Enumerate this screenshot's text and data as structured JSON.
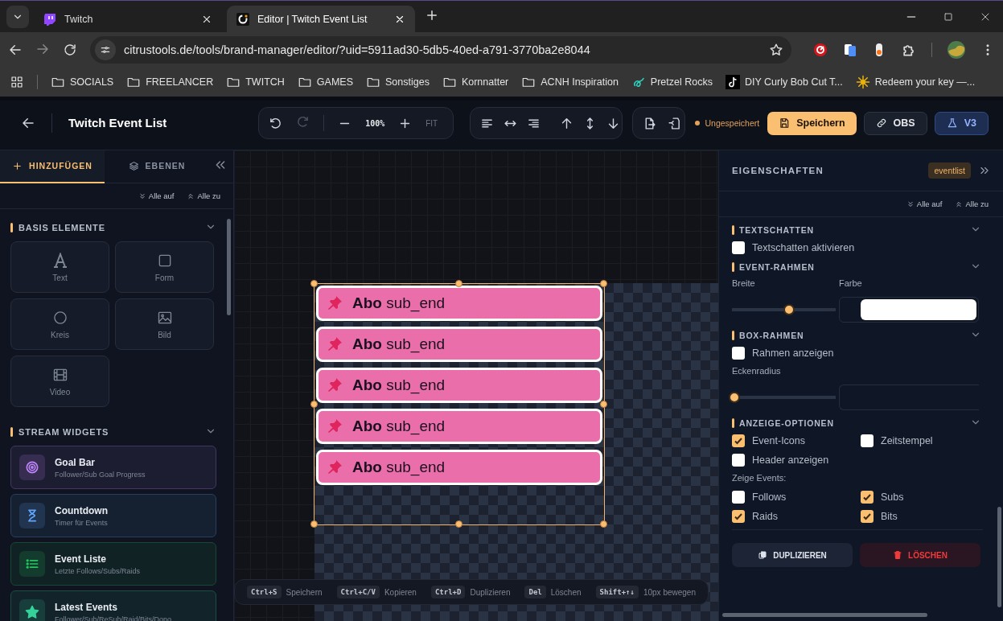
{
  "browser": {
    "tabs": [
      {
        "title": "Twitch",
        "kind": "twitch",
        "selected": false
      },
      {
        "title": "Editor | Twitch Event List",
        "kind": "citrus",
        "selected": true
      }
    ],
    "url": "citrustools.de/tools/brand-manager/editor/?uid=5911ad30-5db5-40ed-a791-3770ba2e8044",
    "bookmarks": [
      {
        "label": "SOCIALS",
        "kind": "folder"
      },
      {
        "label": "FREELANCER",
        "kind": "folder"
      },
      {
        "label": "TWITCH",
        "kind": "folder"
      },
      {
        "label": "GAMES",
        "kind": "folder"
      },
      {
        "label": "Sonstiges",
        "kind": "folder"
      },
      {
        "label": "Kornnatter",
        "kind": "folder"
      },
      {
        "label": "ACNH Inspiration",
        "kind": "folder"
      },
      {
        "label": "Pretzel Rocks",
        "kind": "swirl"
      },
      {
        "label": "DIY Curly Bob Cut T...",
        "kind": "note"
      },
      {
        "label": "Redeem your key —...",
        "kind": "emblem"
      }
    ]
  },
  "header": {
    "title": "Twitch Event List",
    "zoom": "100%",
    "fit": "FIT",
    "status": "Ungespeichert",
    "save": "Speichern",
    "obs": "OBS",
    "version": "V3"
  },
  "left_panel": {
    "tabs": [
      {
        "label": "HINZUFÜGEN",
        "kind": "plus",
        "selected": true
      },
      {
        "label": "EBENEN",
        "kind": "layers",
        "selected": false
      }
    ],
    "expand_all": "Alle auf",
    "collapse_all": "Alle zu",
    "basic_section": {
      "title": "BASIS ELEMENTE",
      "items": [
        {
          "label": "Text",
          "kind": "text"
        },
        {
          "label": "Form",
          "kind": "square"
        },
        {
          "label": "Kreis",
          "kind": "circle"
        },
        {
          "label": "Bild",
          "kind": "image"
        },
        {
          "label": "Video",
          "kind": "film"
        }
      ]
    },
    "widget_section": {
      "title": "STREAM WIDGETS",
      "items": [
        {
          "title": "Goal Bar",
          "subtitle": "Follower/Sub Goal Progress",
          "kind": "target",
          "color": "#c084fc"
        },
        {
          "title": "Countdown",
          "subtitle": "Timer für Events",
          "kind": "hourglass",
          "color": "#60a5fa"
        },
        {
          "title": "Event Liste",
          "subtitle": "Letzte Follows/Subs/Raids",
          "kind": "list",
          "color": "#22c55e"
        },
        {
          "title": "Latest Events",
          "subtitle": "Follower/Sub/ReSub/Raid/Bits/Dono",
          "kind": "star",
          "color": "#34d399"
        }
      ]
    }
  },
  "canvas": {
    "events": [
      {
        "text": "**Abo** sub_end"
      },
      {
        "text": "**Abo** sub_end"
      },
      {
        "text": "**Abo** sub_end"
      },
      {
        "text": "**Abo** sub_end"
      },
      {
        "text": "**Abo** sub_end"
      }
    ],
    "shortcuts": [
      {
        "key": "Ctrl+S",
        "label": "Speichern"
      },
      {
        "key": "Ctrl+C/V",
        "label": "Kopieren"
      },
      {
        "key": "Ctrl+D",
        "label": "Duplizieren"
      },
      {
        "key": "Del",
        "label": "Löschen"
      },
      {
        "key": "Shift+↑↓",
        "label": "10px bewegen"
      }
    ]
  },
  "properties": {
    "title": "EIGENSCHAFTEN",
    "badge": "eventlist",
    "expand_all": "Alle auf",
    "collapse_all": "Alle zu",
    "sections": [
      {
        "title": "TEXTSCHATTEN",
        "blocks": [
          {
            "kind": "checkboxes",
            "items": [
              {
                "label": "Textschatten aktivieren",
                "checked": false
              }
            ]
          }
        ]
      },
      {
        "title": "EVENT-RAHMEN",
        "blocks": [
          {
            "kind": "colorslider",
            "label": "Breite",
            "field_label": "Farbe",
            "level": 0.55
          }
        ]
      },
      {
        "title": "BOX-RAHMEN",
        "blocks": [
          {
            "kind": "checkboxes",
            "items": [
              {
                "label": "Rahmen anzeigen",
                "checked": false
              }
            ]
          },
          {
            "kind": "numberslider",
            "label": "Eckenradius",
            "level": 0.02
          }
        ]
      },
      {
        "title": "ANZEIGE-OPTIONEN",
        "blocks": [
          {
            "kind": "checkboxes",
            "items": [
              {
                "label": "Event-Icons",
                "checked": true
              },
              {
                "label": "Zeitstempel",
                "checked": false
              },
              {
                "label": "Header anzeigen",
                "checked": false
              }
            ]
          },
          {
            "kind": "note",
            "text": "Zeige Events:"
          },
          {
            "kind": "checkboxes",
            "items": [
              {
                "label": "Follows",
                "checked": false
              },
              {
                "label": "Subs",
                "checked": true
              },
              {
                "label": "Raids",
                "checked": true
              },
              {
                "label": "Bits",
                "checked": true
              }
            ]
          }
        ]
      }
    ],
    "duplicate": "DUPLIZIEREN",
    "delete": "LÖSCHEN"
  }
}
